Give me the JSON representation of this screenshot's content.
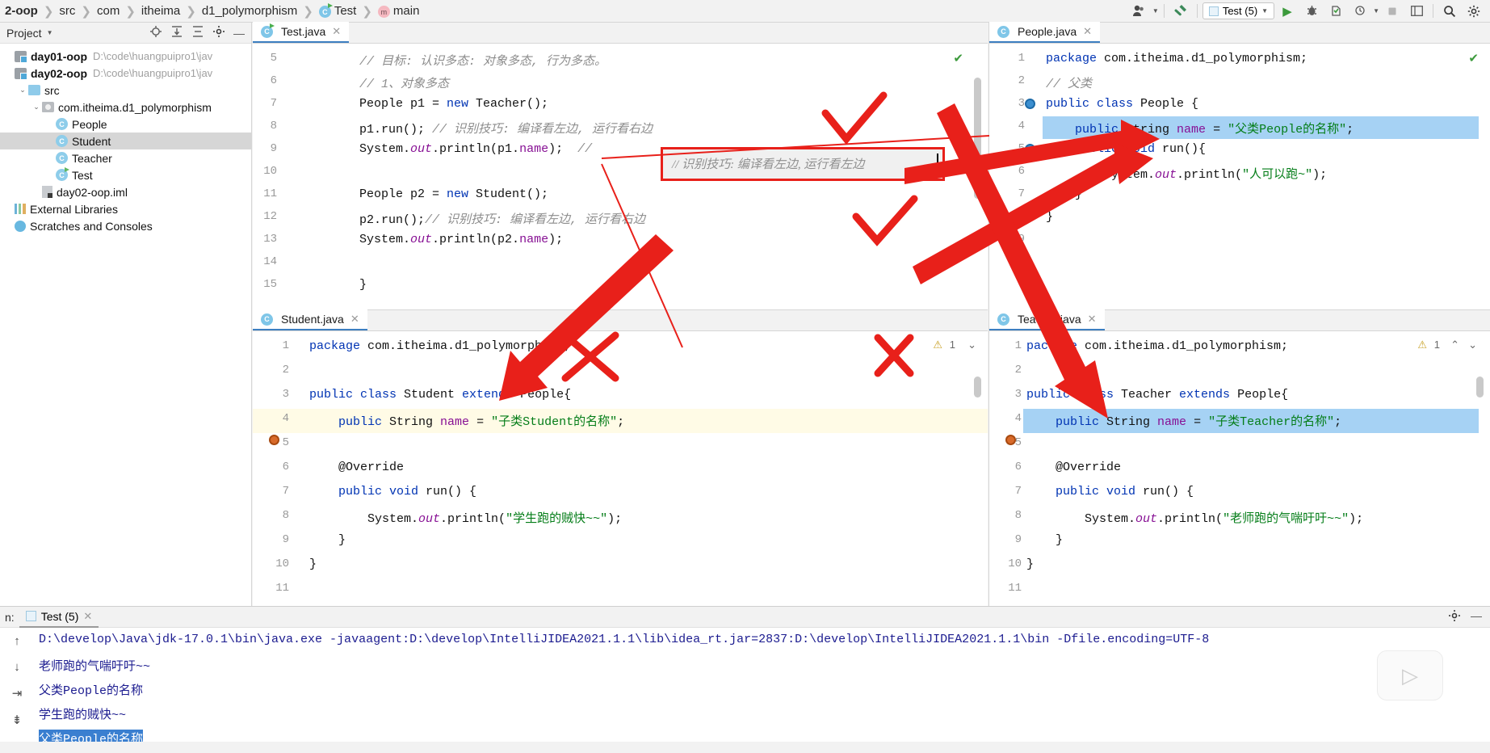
{
  "breadcrumb": {
    "items": [
      {
        "label": "2-oop",
        "icon": "",
        "bold": true
      },
      {
        "label": "src",
        "icon": ""
      },
      {
        "label": "com",
        "icon": ""
      },
      {
        "label": "itheima",
        "icon": ""
      },
      {
        "label": "d1_polymorphism",
        "icon": ""
      },
      {
        "label": "Test",
        "icon": "class-run-icon"
      },
      {
        "label": "main",
        "icon": "method-icon"
      }
    ]
  },
  "toolbar": {
    "user_icon": "user-icon",
    "build_icon": "hammer-icon",
    "run_config": "Test (5)",
    "run_icon": "run-icon",
    "debug_icon": "debug-icon",
    "coverage_icon": "coverage-icon",
    "profiler_icon": "profiler-icon",
    "stop_icon": "stop-icon",
    "layout_icon": "layout-icon",
    "search_icon": "search-icon",
    "settings_icon": "settings-icon"
  },
  "sidebar": {
    "title": "Project",
    "header_icons": [
      "locate-icon",
      "expand-all-icon",
      "collapse-all-icon",
      "gear-icon",
      "minimize-icon"
    ],
    "items": [
      {
        "label": "day01-oop",
        "path": "D:\\code\\huangpuipro1\\jav",
        "icon": "module-icon",
        "indent": 0,
        "bold": true,
        "arrow": ""
      },
      {
        "label": "day02-oop",
        "path": "D:\\code\\huangpuipro1\\jav",
        "icon": "module-icon",
        "indent": 0,
        "bold": true,
        "arrow": ""
      },
      {
        "label": "src",
        "path": "",
        "icon": "folder-icon",
        "indent": 1,
        "bold": false,
        "arrow": "v"
      },
      {
        "label": "com.itheima.d1_polymorphism",
        "path": "",
        "icon": "package-icon",
        "indent": 2,
        "bold": false,
        "arrow": "v"
      },
      {
        "label": "People",
        "path": "",
        "icon": "class-icon",
        "indent": 3,
        "bold": false,
        "arrow": ""
      },
      {
        "label": "Student",
        "path": "",
        "icon": "class-icon",
        "indent": 3,
        "bold": false,
        "arrow": "",
        "selected": true
      },
      {
        "label": "Teacher",
        "path": "",
        "icon": "class-icon",
        "indent": 3,
        "bold": false,
        "arrow": ""
      },
      {
        "label": "Test",
        "path": "",
        "icon": "class-run-icon",
        "indent": 3,
        "bold": false,
        "arrow": ""
      },
      {
        "label": "day02-oop.iml",
        "path": "",
        "icon": "iml-icon",
        "indent": 2,
        "bold": false,
        "arrow": ""
      },
      {
        "label": "External Libraries",
        "path": "",
        "icon": "library-icon",
        "indent": 0,
        "bold": false,
        "arrow": ""
      },
      {
        "label": "Scratches and Consoles",
        "path": "",
        "icon": "scratch-icon",
        "indent": 0,
        "bold": false,
        "arrow": ""
      }
    ]
  },
  "editors": {
    "test": {
      "tab": "Test.java",
      "first_line": 5,
      "lines": [
        {
          "n": 5,
          "html": "<span class='cm'>// 目标: 认识多态: 对象多态, 行为多态。</span>"
        },
        {
          "n": 6,
          "html": "<span class='cm'>// 1、对象多态</span>"
        },
        {
          "n": 7,
          "html": "People p1 = <span class='kw'>new</span> Teacher();"
        },
        {
          "n": 8,
          "html": "p1.run(); <span class='cm'>// 识别技巧: 编译看左边, 运行看右边</span>"
        },
        {
          "n": 9,
          "html": "System.<span class='fl'>out</span>.println(p1.<span class='fld'>name</span>);  <span class='cm'>//</span>"
        },
        {
          "n": 10,
          "html": ""
        },
        {
          "n": 11,
          "html": "People p2 = <span class='kw'>new</span> Student();"
        },
        {
          "n": 12,
          "html": "p2.run();<span class='cm'>// 识别技巧: 编译看左边, 运行看右边</span>"
        },
        {
          "n": 13,
          "html": "System.<span class='fl'>out</span>.println(p2.<span class='fld'>name</span>);"
        },
        {
          "n": 14,
          "html": ""
        },
        {
          "n": 15,
          "html": "}"
        }
      ],
      "status_icon": "inspection-ok-icon"
    },
    "people": {
      "tab": "People.java",
      "lines": [
        {
          "n": 1,
          "html": "<span class='kw'>package</span> com.itheima.d1_polymorphism;"
        },
        {
          "n": 2,
          "html": "<span class='cm'>// 父类</span>"
        },
        {
          "n": 3,
          "html": "<span class='kw'>public class</span> People {"
        },
        {
          "n": 4,
          "html": "    <span class='kw'>public</span> String <span class='fld'>name</span> = <span class='st'>\"父类People的名称\"</span>;",
          "selected": true
        },
        {
          "n": 5,
          "html": "    <span class='kw'>public void</span> run(){"
        },
        {
          "n": 6,
          "html": "        System.<span class='fl'>out</span>.println(<span class='st'>\"人可以跑~\"</span>);"
        },
        {
          "n": 7,
          "html": "    }"
        },
        {
          "n": 8,
          "html": "}"
        },
        {
          "n": 9,
          "html": ""
        }
      ],
      "status_icon": "inspection-ok-icon"
    },
    "student": {
      "tab": "Student.java",
      "lines": [
        {
          "n": 1,
          "html": "<span class='kw'>package</span> com.itheima.d1_polymorphism;"
        },
        {
          "n": 2,
          "html": ""
        },
        {
          "n": 3,
          "html": "<span class='kw'>public class</span> Student <span class='kw'>extends</span> People{"
        },
        {
          "n": 4,
          "html": "    <span class='kw'>public</span> String <span class='fld'>name</span> = <span class='st'>\"子类Student的名称\"</span>;",
          "highlight": true
        },
        {
          "n": 5,
          "html": ""
        },
        {
          "n": 6,
          "html": "    @Override"
        },
        {
          "n": 7,
          "html": "    <span class='kw'>public void</span> run() {"
        },
        {
          "n": 8,
          "html": "        System.<span class='fl'>out</span>.println(<span class='st'>\"学生跑的贼快~~\"</span>);"
        },
        {
          "n": 9,
          "html": "    }"
        },
        {
          "n": 10,
          "html": "}"
        },
        {
          "n": 11,
          "html": ""
        }
      ],
      "warning_count": "1",
      "status_icon": "warning-icon"
    },
    "teacher": {
      "tab": "Teacher.java",
      "lines": [
        {
          "n": 1,
          "html": "<span class='kw'>package</span> com.itheima.d1_polymorphism;"
        },
        {
          "n": 2,
          "html": ""
        },
        {
          "n": 3,
          "html": "<span class='kw'>public class</span> Teacher <span class='kw'>extends</span> People{"
        },
        {
          "n": 4,
          "html": "    <span class='kw'>public</span> String <span class='fld'>name</span> = <span class='st'>\"子类Teacher的名称\"</span>;",
          "selected": true
        },
        {
          "n": 5,
          "html": ""
        },
        {
          "n": 6,
          "html": "    @Override"
        },
        {
          "n": 7,
          "html": "    <span class='kw'>public void</span> run() {"
        },
        {
          "n": 8,
          "html": "        System.<span class='fl'>out</span>.println(<span class='st'>\"老师跑的气喘吁吁~~\"</span>);"
        },
        {
          "n": 9,
          "html": "    }"
        },
        {
          "n": 10,
          "html": "}"
        },
        {
          "n": 11,
          "html": ""
        }
      ],
      "warning_count": "1",
      "status_icon": "warning-icon"
    }
  },
  "annotation": {
    "inline_box_text": "// 识别技巧: 编译看左边, 运行看左边",
    "color": "#e8201a",
    "marks": [
      "check-mark",
      "check-mark",
      "x-mark",
      "x-mark",
      "arrow",
      "arrow",
      "arrow",
      "arrow"
    ]
  },
  "console": {
    "label": "n:",
    "tab": "Test (5)",
    "rail_icons": [
      "scroll-up-icon",
      "scroll-down-icon",
      "soft-wrap-icon",
      "print-icon",
      "more-icon"
    ],
    "settings_icon": "gear-icon",
    "minimize_icon": "minimize-icon",
    "lines": [
      {
        "text": "D:\\develop\\Java\\jdk-17.0.1\\bin\\java.exe -javaagent:D:\\develop\\IntelliJIDEA2021.1.1\\lib\\idea_rt.jar=2837:D:\\develop\\IntelliJIDEA2021.1.1\\bin -Dfile.encoding=UTF-8",
        "selected": false
      },
      {
        "text": "老师跑的气喘吁吁~~",
        "selected": false
      },
      {
        "text": "父类People的名称",
        "selected": false
      },
      {
        "text": "学生跑的贼快~~",
        "selected": false
      },
      {
        "text": "父类People的名称",
        "selected": true
      }
    ]
  }
}
